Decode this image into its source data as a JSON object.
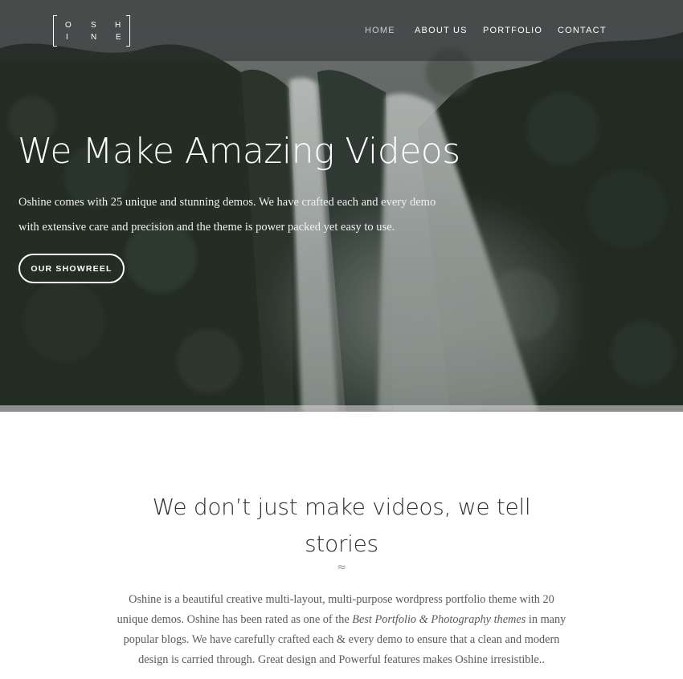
{
  "brand": {
    "logo_letters": [
      "O",
      "S",
      "H",
      "I",
      "N",
      "E"
    ]
  },
  "nav": {
    "items": [
      {
        "label": "HOME",
        "active": true
      },
      {
        "label": "ABOUT US",
        "active": false
      },
      {
        "label": "PORTFOLIO",
        "active": false
      },
      {
        "label": "CONTACT",
        "active": false
      }
    ]
  },
  "hero": {
    "title": "We Make Amazing Videos",
    "text": "Oshine comes with 25 unique and stunning demos. We have crafted each and every demo with extensive care and precision and the theme is power packed yet easy to use.",
    "button_label": "OUR SHOWREEL",
    "background_description_colors": {
      "foliage": "#2b3a2e",
      "waterfall": "#c9cfcc",
      "sky": "#d8dcd8"
    }
  },
  "intro": {
    "title_line1": "We don’t just make videos, we tell",
    "title_line2": "stories",
    "divider_icon": "wave-icon",
    "divider_glyph": "≈",
    "text_part1": "Oshine is a beautiful creative multi-layout, multi-purpose wordpress portfolio theme with 20 unique demos. Oshine has been rated as one of the ",
    "text_emphasis": "Best Portfolio & Photography themes",
    "text_part2": " in many popular blogs. We have carefully crafted each & every demo to ensure that a clean and modern design is carried through. Great design and Powerful features makes Oshine irresistible.."
  }
}
